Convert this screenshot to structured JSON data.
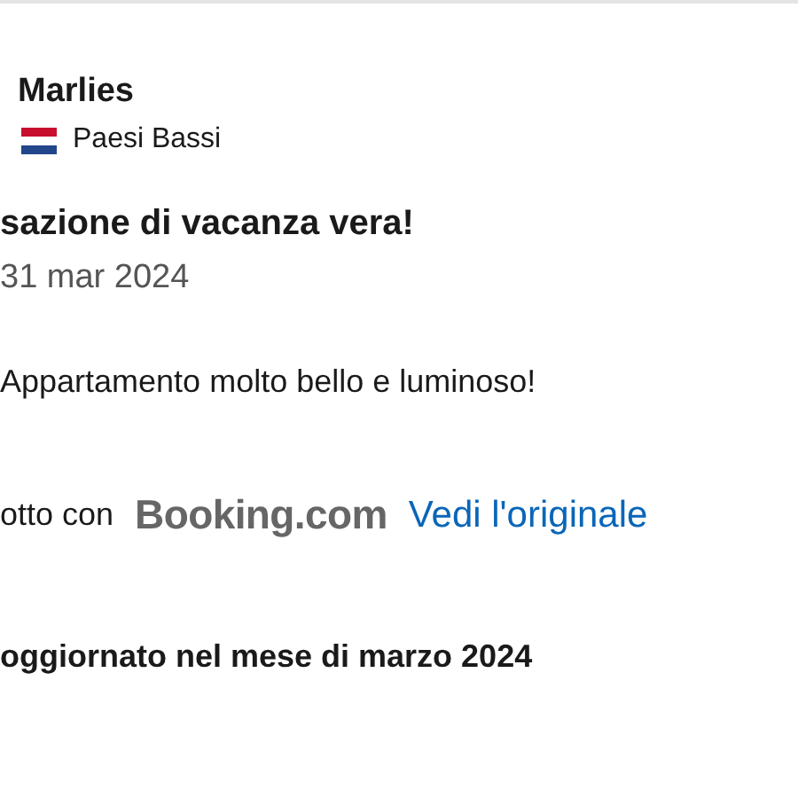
{
  "reviewer": {
    "name": "Marlies",
    "country": "Paesi Bassi"
  },
  "review": {
    "title": "sazione di vacanza vera!",
    "date": "31 mar 2024",
    "text": "Appartamento molto bello e luminoso!"
  },
  "translation": {
    "label": "otto con",
    "provider": "Booking.com",
    "link": "Vedi l'originale"
  },
  "stay": "oggiornato nel mese di marzo 2024"
}
